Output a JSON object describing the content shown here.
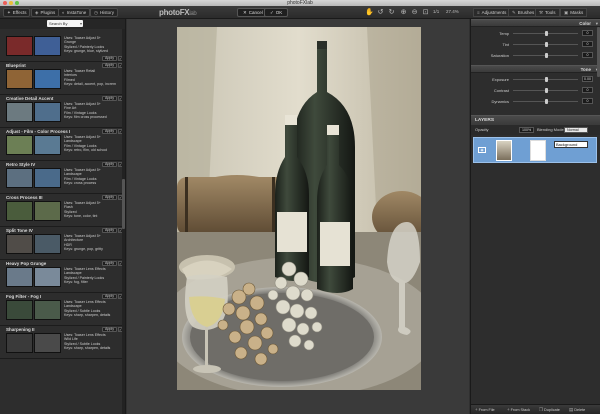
{
  "window": {
    "title": "photoFXlab"
  },
  "toolbar": {
    "tabs_left": [
      {
        "label": "Effects",
        "icon": "sparkle-icon"
      },
      {
        "label": "Plugins",
        "icon": "puzzle-icon"
      },
      {
        "label": "InstaTone",
        "icon": "palette-icon"
      },
      {
        "label": "History",
        "icon": "clock-icon"
      }
    ],
    "logo_main": "photoFX",
    "logo_sub": "lab",
    "cancel_label": "Cancel",
    "ok_label": "OK",
    "zoom_value": "1/1",
    "zoom_percent": "27.4%",
    "tabs_right": [
      {
        "label": "Adjustments",
        "icon": "sliders-icon"
      },
      {
        "label": "Brushes",
        "icon": "brush-icon"
      },
      {
        "label": "Tools",
        "icon": "wrench-icon"
      },
      {
        "label": "Masks",
        "icon": "mask-icon"
      }
    ]
  },
  "search": {
    "placeholder": "Search By"
  },
  "effects": [
    {
      "title": "",
      "lines": [
        "Uses: Toaser Adjust 5+",
        "Grunge",
        "Stylized / Painterly Looks",
        "Keys: grunge, blue, stylized"
      ],
      "colors": [
        "#7a2a2a",
        "#3f5f96"
      ]
    },
    {
      "title": "Blueprint",
      "lines": [
        "Uses: Toaser Retail",
        "Interiors",
        "Filmed",
        "Keys: detail, accent, pop, increm"
      ],
      "colors": [
        "#8f6436",
        "#3d6fa8"
      ]
    },
    {
      "title": "Creative Detail Accent",
      "lines": [
        "Uses: Toaser Adjust 5+",
        "Fine Art",
        "Film / Vintage Looks",
        "Keys: film cross processed"
      ],
      "colors": [
        "#6c7a80",
        "#4f6e8c"
      ]
    },
    {
      "title": "Adjust - Film - Color Process I",
      "lines": [
        "Uses: Toaser Adjust 5+",
        "Landscape",
        "Film / Vintage Looks",
        "Keys: retro, film, old school"
      ],
      "colors": [
        "#6c7f55",
        "#5a7a93"
      ]
    },
    {
      "title": "Retro Style IV",
      "lines": [
        "Uses: Toaser Adjust 5+",
        "Landscape",
        "Film / Vintage Looks",
        "Keys: cross process"
      ],
      "colors": [
        "#5c6f80",
        "#4a6a8a"
      ]
    },
    {
      "title": "Cross Process III",
      "lines": [
        "Uses: Toaser Adjust 5+",
        "Flash",
        "Stylized",
        "Keys: tone, color, tint"
      ],
      "colors": [
        "#4a5c3c",
        "#5c6a4a"
      ]
    },
    {
      "title": "Split Tone IV",
      "lines": [
        "Uses: Toaser Adjust 5+",
        "Architecture",
        "HDR",
        "Keys: grunge, pop, gritty"
      ],
      "colors": [
        "#504c48",
        "#4a5a66"
      ]
    },
    {
      "title": "Heavy Pop Grunge",
      "lines": [
        "Uses: Toaser Lens Effects",
        "Landscape",
        "Stylized / Painterly Looks",
        "Keys: fog, filter"
      ],
      "colors": [
        "#6a7a8a",
        "#7a8a9a"
      ]
    },
    {
      "title": "Fog Filter - Fog I",
      "lines": [
        "Uses: Toaser Lens Effects",
        "Landscape",
        "Stylized / Subtle Looks",
        "Keys: sharp, sharpen, details"
      ],
      "colors": [
        "#3a4a3a",
        "#4a5a4a"
      ]
    },
    {
      "title": "Sharpening II",
      "lines": [
        "Uses: Toaser Lens Effects",
        "Wild Life",
        "Stylized / Subtle Looks",
        "Keys: sharp, sharpen, details"
      ],
      "colors": [
        "#3a3a3a",
        "#4a4a4a"
      ]
    }
  ],
  "effect_apply_label": "Apply",
  "color_section": {
    "title": "Color",
    "rows": [
      {
        "label": "Temp",
        "value": "0",
        "fraction": 0.5
      },
      {
        "label": "Tint",
        "value": "0",
        "fraction": 0.5
      },
      {
        "label": "Saturation",
        "value": "0",
        "fraction": 0.5
      }
    ]
  },
  "tone_section": {
    "title": "Tone",
    "rows": [
      {
        "label": "Exposure",
        "value": "0.00",
        "fraction": 0.5
      },
      {
        "label": "Contrast",
        "value": "0",
        "fraction": 0.5
      },
      {
        "label": "Dynamics",
        "value": "0",
        "fraction": 0.5
      }
    ]
  },
  "layers": {
    "title": "LAYERS",
    "opacity_label": "Opacity",
    "opacity_value": "100%",
    "blend_label": "Blending Mode",
    "blend_value": "Normal",
    "layer_name": "Background",
    "footer": [
      {
        "label": "From File",
        "icon": "plus-icon"
      },
      {
        "label": "From Stack",
        "icon": "plus-icon"
      },
      {
        "label": "Duplicate",
        "icon": "duplicate-icon"
      },
      {
        "label": "Delete",
        "icon": "trash-icon"
      }
    ]
  },
  "colors": {
    "accent_selection": "#6f9fd3",
    "panel_bg": "#2d2d2d"
  }
}
